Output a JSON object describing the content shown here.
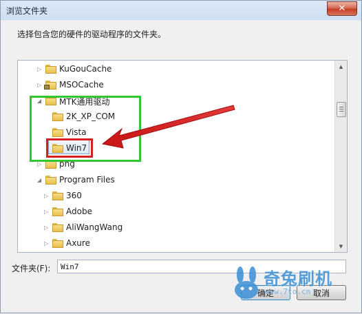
{
  "window": {
    "title": "浏览文件夹",
    "close_glyph": "✕",
    "prompt": "选择包含您的硬件的驱动程序的文件夹。"
  },
  "tree": {
    "items": [
      {
        "label": "KuGouCache",
        "expander": "▷",
        "locked": false
      },
      {
        "label": "MSOCache",
        "expander": "▷",
        "locked": true
      },
      {
        "label": "MTK通用驱动",
        "expander": "◢",
        "locked": false
      },
      {
        "label": "2K_XP_COM",
        "expander": "",
        "locked": false
      },
      {
        "label": "Vista",
        "expander": "",
        "locked": false
      },
      {
        "label": "Win7",
        "expander": "",
        "locked": false,
        "selected": true
      },
      {
        "label": "png",
        "expander": "▷",
        "locked": false
      },
      {
        "label": "Program Files",
        "expander": "◢",
        "locked": false
      },
      {
        "label": "360",
        "expander": "▷",
        "locked": false
      },
      {
        "label": "Adobe",
        "expander": "▷",
        "locked": false
      },
      {
        "label": "AliWangWang",
        "expander": "▷",
        "locked": false
      },
      {
        "label": "Axure",
        "expander": "▷",
        "locked": false
      }
    ],
    "scroll_up": "▲",
    "scroll_down": "▼"
  },
  "path": {
    "label": "文件夹(F):",
    "value": "Win7"
  },
  "buttons": {
    "ok": "确定",
    "cancel": "取消"
  },
  "watermark": {
    "brand": "奇兔刷机",
    "url": "www.7to.cn"
  },
  "annotations": {
    "highlight_green": "#2fc82f",
    "highlight_red": "#d62020"
  }
}
